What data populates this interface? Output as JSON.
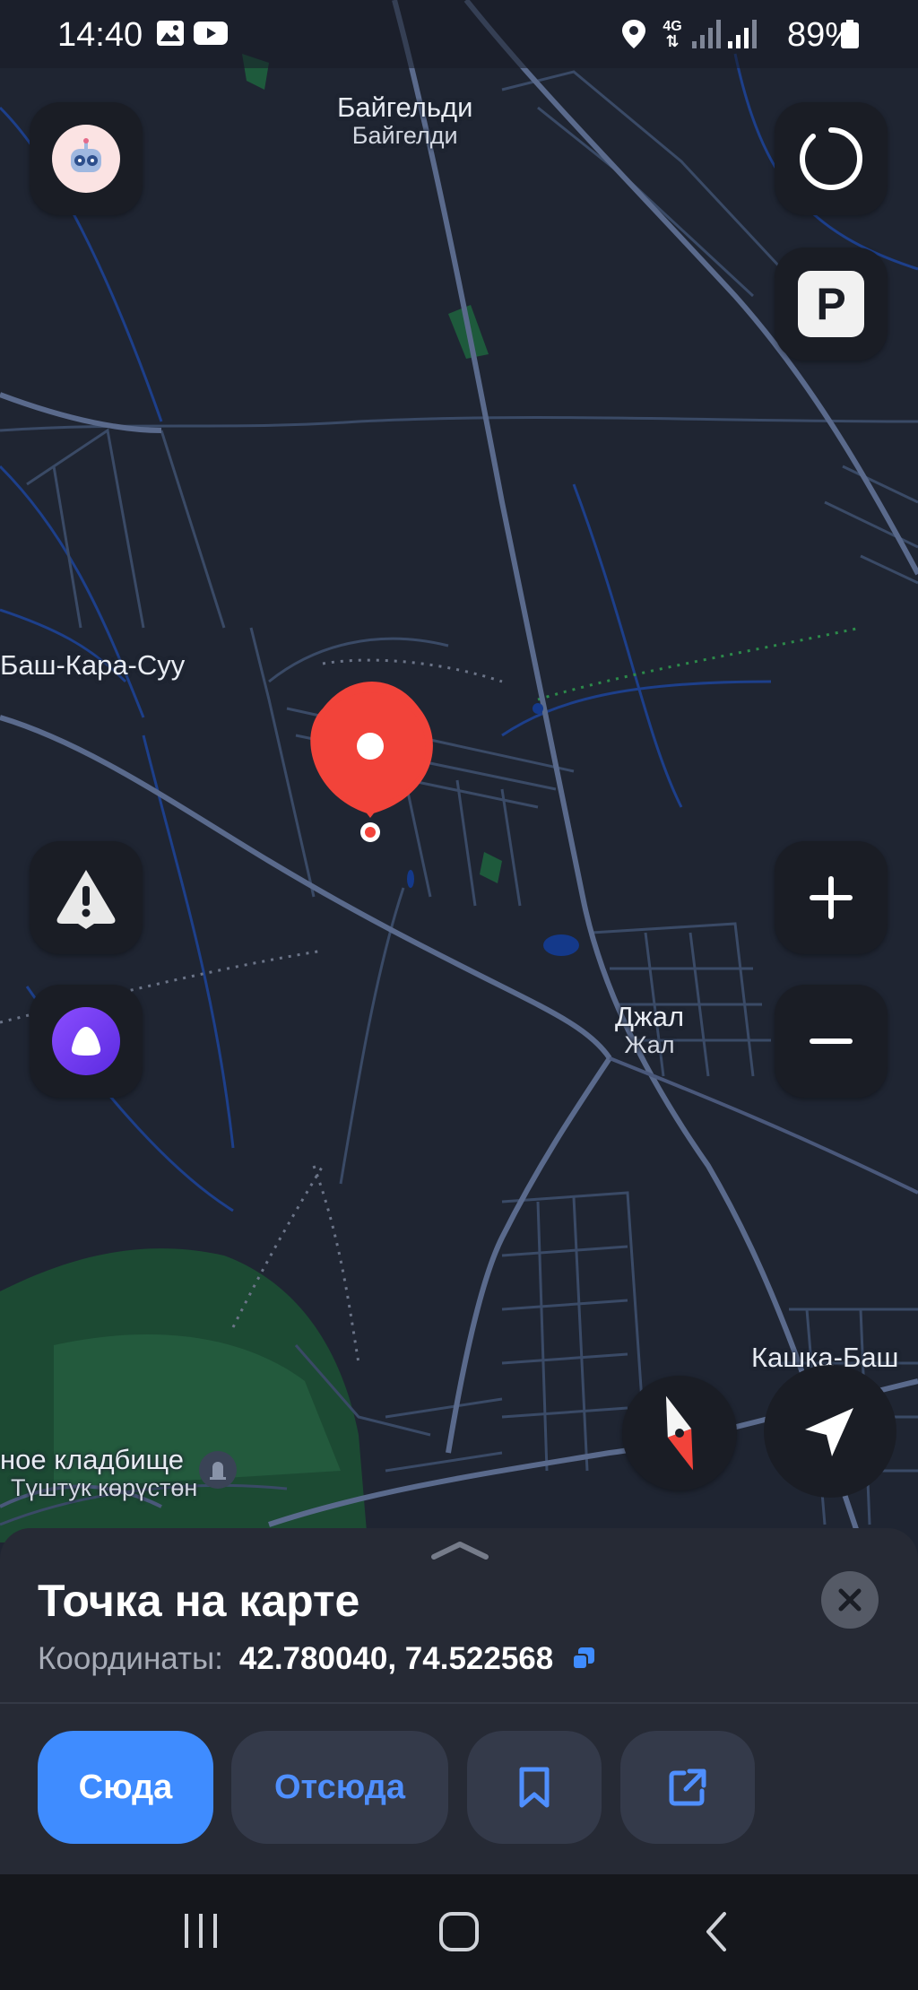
{
  "status_bar": {
    "time": "14:40",
    "network": "4G",
    "battery": "89%"
  },
  "map": {
    "places": [
      {
        "name": "Байгельди",
        "subname": "Байгелди"
      },
      {
        "name": "Баш-Кара-Суу",
        "subname": ""
      },
      {
        "name": "Джал",
        "subname": "Жал"
      },
      {
        "name": "Кашка-Баш",
        "subname": ""
      },
      {
        "name": "ное кладбище",
        "subname": "Түштук көрүстөн"
      }
    ],
    "pin_color": "#f2433a",
    "park_color": "#1f5a3c"
  },
  "controls": {
    "parking_label": "P",
    "zoom_in": "+",
    "zoom_out": "−"
  },
  "sheet": {
    "title": "Точка на карте",
    "coords_label": "Координаты:",
    "coords_value": "42.780040, 74.522568",
    "actions": {
      "to_here": "Сюда",
      "from_here": "Отсюда"
    }
  },
  "colors": {
    "accent": "#3f8cff",
    "background": "#1f2532"
  }
}
